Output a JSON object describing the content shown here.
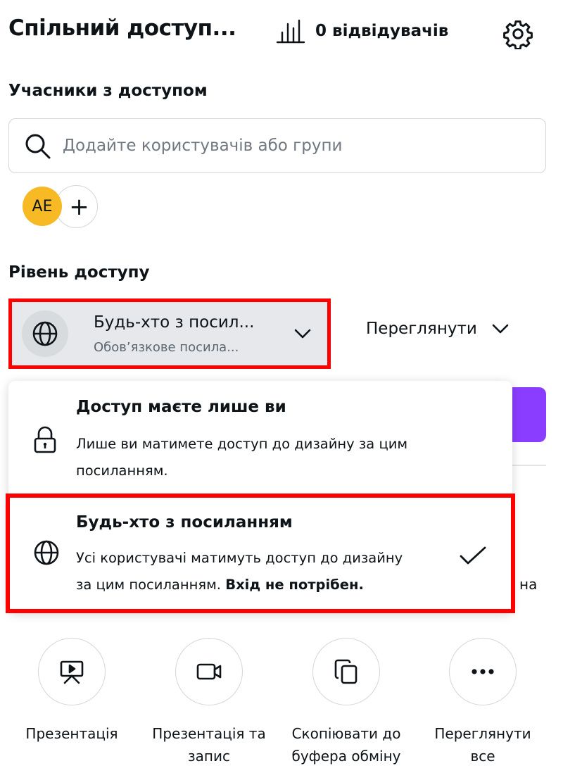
{
  "header": {
    "title": "Спільний доступ...",
    "visitors_label": "0 відвідувачів"
  },
  "people": {
    "label": "Учасники з доступом",
    "search_placeholder": "Додайте користувачів або групи",
    "avatar_initials": "AE",
    "add_label": "+"
  },
  "access": {
    "label": "Рівень доступу",
    "selected_title": "Будь-хто з посил...",
    "selected_subtitle": "Обов’язкове посила...",
    "view_label": "Переглянути"
  },
  "dropdown": {
    "options": [
      {
        "title": "Доступ маєте лише ви",
        "desc_line1": "Лише ви матимете доступ до дизайну за цим",
        "desc_line2": "посиланням."
      },
      {
        "title": "Будь-хто з посиланням",
        "desc_line1": "Усі користувачі матимуть доступ до дизайну",
        "desc_line2": "за цим посиланням.",
        "desc_bold": "Вхід не потрібен.",
        "selected": true
      }
    ]
  },
  "partial_text": "на",
  "actions": [
    {
      "label_line1": "Презентація",
      "label_line2": "",
      "icon": "presentation-icon"
    },
    {
      "label_line1": "Презентація та",
      "label_line2": "запис",
      "icon": "video-camera-icon"
    },
    {
      "label_line1": "Скопіювати до",
      "label_line2": "буфера обміну",
      "icon": "copy-icon"
    },
    {
      "label_line1": "Переглянути",
      "label_line2": "все",
      "icon": "more-icon"
    }
  ],
  "colors": {
    "accent_purple": "#8b3dff",
    "highlight_red": "#ff0000",
    "avatar_yellow": "#f7b924",
    "select_bg": "#e6e8eb"
  }
}
